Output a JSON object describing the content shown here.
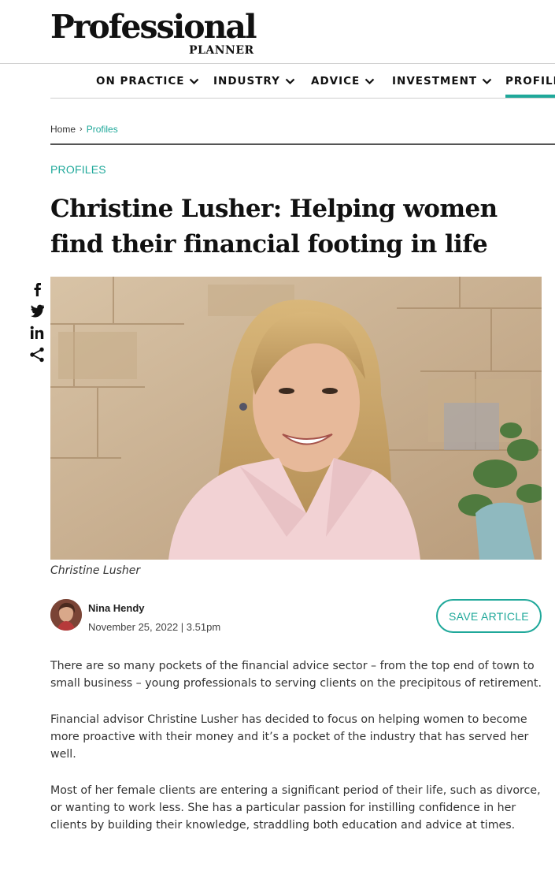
{
  "logo": {
    "main": "Professional",
    "sub": "PLANNER"
  },
  "nav": {
    "items": [
      {
        "label": "ON PRACTICE"
      },
      {
        "label": "INDUSTRY"
      },
      {
        "label": "ADVICE"
      },
      {
        "label": "INVESTMENT"
      },
      {
        "label": "PROFILE"
      }
    ],
    "active_color": "#1fa89a"
  },
  "breadcrumb": {
    "home": "Home",
    "separator": "›",
    "current": "Profiles"
  },
  "article": {
    "category": "PROFILES",
    "title": "Christine Lusher: Helping women find their financial footing in life",
    "photo_caption": "Christine Lusher",
    "author": {
      "name": "Nina Hendy",
      "date": "November 25, 2022 | 3.51pm"
    },
    "save_label": "SAVE ARTICLE",
    "paragraphs": [
      "There are so many pockets of the financial advice sector – from the top end of town to small business – young professionals to serving clients on the precipitous of retirement.",
      "Financial advisor Christine Lusher has decided to focus on helping women to become more proactive with their money and it’s a pocket of the industry that has served her well.",
      "Most of her female clients are entering a significant period of their life, such as divorce, or wanting to work less. She has a particular passion for instilling confidence in her clients by building their knowledge, straddling both education and advice at times."
    ]
  },
  "share": {
    "icons": [
      "facebook-icon",
      "twitter-icon",
      "linkedin-icon",
      "share-icon"
    ]
  },
  "colors": {
    "accent": "#1fa89a",
    "text": "#222222"
  }
}
